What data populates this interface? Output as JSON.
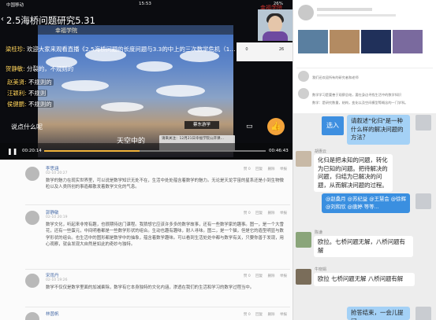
{
  "status_bar": {
    "carrier": "中国移动",
    "time": "15:53",
    "battery": "26%"
  },
  "live": {
    "title": "2.5海桥问题研究5.31",
    "video_brand": "幸福学院",
    "cam_brand": "幸福学院",
    "chat": [
      {
        "name": "梁桂珍:",
        "text": "欢迎大家来观看直播《2.5海桥问题的长度问题与3.3的中上的三次数学危机（1…"
      },
      {
        "name": "贺静敏:",
        "text": "分裂的，不规则的"
      },
      {
        "name": "赵美贤:",
        "text": "不规则的"
      },
      {
        "name": "汪颖利:",
        "text": "不规则"
      },
      {
        "name": "侯健鹏:",
        "text": "不规则的"
      }
    ],
    "saying": "说点什么呢",
    "in_video_text": "天空中的",
    "teacher_tag": "蔡东游学",
    "notice": "请来关注：12月21日幸福学院公开课…",
    "time_current": "00:20:14",
    "time_total": "00:46:43",
    "progress": 0.43,
    "panel_numbers": [
      "0",
      "26"
    ]
  },
  "forum": {
    "posts": [
      {
        "name": "李思涵",
        "time": "02-10 20:27",
        "meta": [
          "赞 0",
          "回复",
          "删除",
          "举报"
        ],
        "body": "数学的魅力在现实世界里，可以说是数学知识无处不在，生活中处处蕴含着数学的魅力。无论是天龙宇宙的星系还是小到生物微粒以及人类所创的事造都散发着数学文化的气息。"
      },
      {
        "name": "郭静敏",
        "time": "02-10 20:19",
        "meta": [
          "赞 0",
          "回复",
          "删除",
          "举报"
        ],
        "body": "数学文化，听起来非常有趣，也很期待这门课程。我猜想它应该许多多的数学故事，还有一些数学家的趣事。图一，是一个大雪花，还有一些蛋元，中间明看都是一些数学形状的组合。生动也趣有趣味，耐人寻味。图二，是一个猫，但是它的造型明显与数学形状的组合。也生活中的图形都是数学中的抽象，蕴含着数学趣味。可以看到生活处处中都与数学有关，只要你善于发现，用心观察，就会发现大自然是如此的奇妙与独特。"
      },
      {
        "name": "宋雨丹",
        "time": "02-10 19:26",
        "meta": [
          "赞 0",
          "回复",
          "删除",
          "举报"
        ],
        "body": "数学不仅仅是数学里面的加减乘除，数学有它本身独特的文化内涵，渗透在我们的生活和学习的数学过程当中。"
      },
      {
        "name": "林茵帆",
        "time": "",
        "meta": [
          "赞 0",
          "回复",
          "删除",
          "举报"
        ],
        "body": ""
      }
    ]
  },
  "right": {
    "article_line1": "我们还欢迎所有的研究者和老师",
    "article_line2": "数学学习是要善于观察总结，要在身边寻找生活中的数学知识",
    "article_line3": "数学：是研究数量，结构，变化以及空间模型等概念的一门学科。",
    "chat": [
      {
        "type": "send",
        "text": "请叙述\"化归\"是一种什么样的解决问题的方法？",
        "button": "选入"
      },
      {
        "type": "recv",
        "user": "胡惠云",
        "text": "化归是把未知的问题，转化为已知的问题。把待解决的问题，归结为已解决的问题，从而解决问题的过程。"
      },
      {
        "type": "highlight",
        "text": "@赵桑月 @苏纪益 @王慧会 @徐辉 @刘和欣 @唐婷 等等..."
      },
      {
        "type": "recv",
        "user": "陈谦",
        "text": "欧拉。七桥问题无解，八桥问题有解"
      },
      {
        "type": "recv",
        "user": "牛晓娟",
        "text": "欧拉 七桥问题无解 八桥问题有解"
      },
      {
        "type": "send",
        "text": "抢答结束，一会儿提问"
      }
    ]
  },
  "colors": {
    "accent_blue": "#3a8fe0",
    "chat_name": "#ffd45b",
    "live_orange": "#f3a33a"
  }
}
